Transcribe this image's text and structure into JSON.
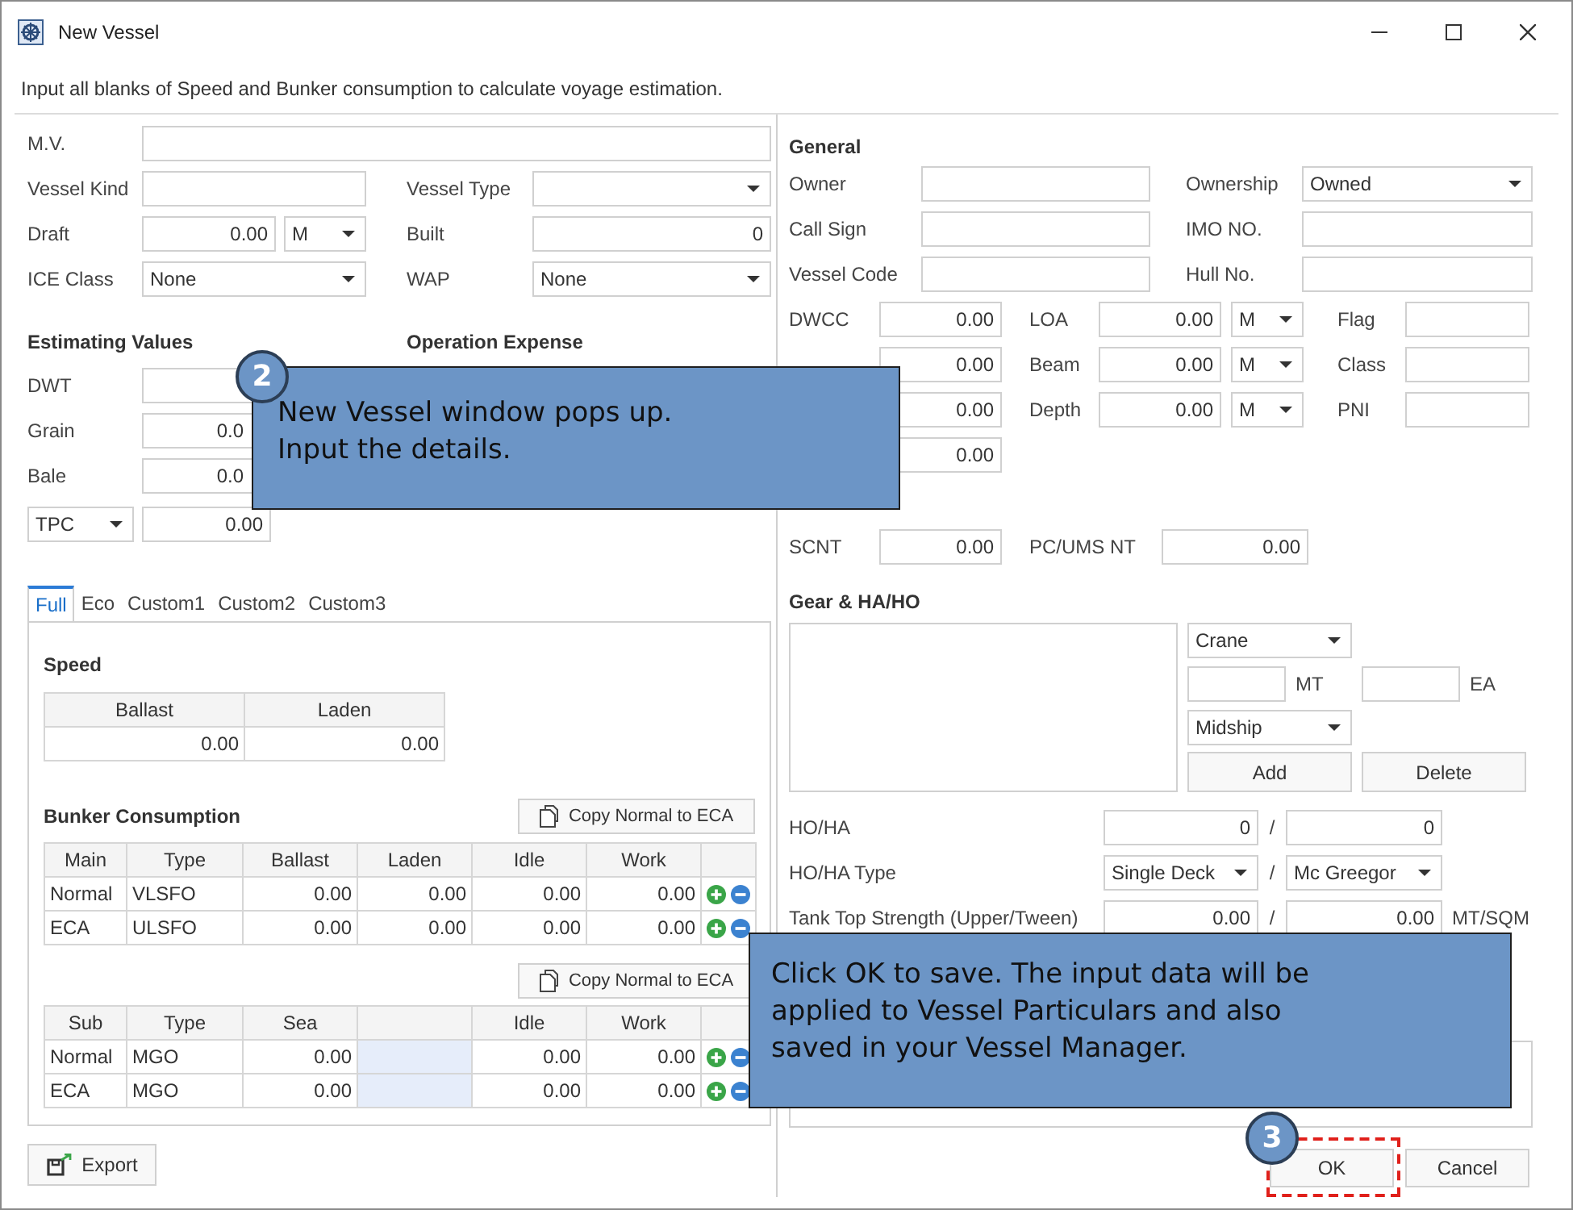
{
  "window": {
    "title": "New Vessel"
  },
  "instruction": "Input all blanks of Speed and Bunker consumption to calculate voyage estimation.",
  "particulars": {
    "rows": [
      {
        "items": [
          {
            "kind": "label",
            "text": "M.V."
          },
          {
            "kind": "text"
          }
        ]
      },
      {
        "items": [
          {
            "kind": "label",
            "text": "Vessel Kind"
          },
          {
            "kind": "text"
          },
          {
            "kind": "label",
            "text": "Vessel Type"
          },
          {
            "kind": "select"
          }
        ]
      },
      {
        "items": [
          {
            "kind": "label",
            "text": "Draft"
          },
          {
            "kind": "number",
            "value": "0.00"
          },
          {
            "kind": "select",
            "value": "M"
          },
          {
            "kind": "label",
            "text": "Built"
          },
          {
            "kind": "number",
            "value": "0"
          }
        ]
      },
      {
        "items": [
          {
            "kind": "label",
            "text": "ICE Class"
          },
          {
            "kind": "select",
            "value": "None"
          },
          {
            "kind": "label",
            "text": "WAP"
          },
          {
            "kind": "select",
            "value": "None"
          }
        ]
      }
    ]
  },
  "estimating": {
    "heading": "Estimating Values",
    "rows": [
      {
        "items": [
          {
            "kind": "label",
            "text": "DWT"
          },
          {
            "kind": "number"
          }
        ]
      },
      {
        "items": [
          {
            "kind": "label",
            "text": "Grain"
          },
          {
            "kind": "number",
            "value": "0.0"
          }
        ]
      },
      {
        "items": [
          {
            "kind": "label",
            "text": "Bale"
          },
          {
            "kind": "number",
            "value": "0.0"
          }
        ]
      },
      {
        "items": [
          {
            "kind": "select",
            "value": "TPC"
          },
          {
            "kind": "number",
            "value": "0.00"
          }
        ]
      }
    ]
  },
  "operation_expense": {
    "heading": "Operation Expense"
  },
  "consumption_tabs": [
    {
      "label": "Full",
      "selected": true
    },
    {
      "label": "Eco",
      "selected": false
    },
    {
      "label": "Custom1",
      "selected": false
    },
    {
      "label": "Custom2",
      "selected": false
    },
    {
      "label": "Custom3",
      "selected": false
    }
  ],
  "speed": {
    "heading": "Speed",
    "columns": [
      "Ballast",
      "Laden"
    ],
    "values": [
      "0.00",
      "0.00"
    ]
  },
  "bunker": {
    "heading": "Bunker Consumption",
    "copy_button": "Copy Normal to ECA",
    "columns": [
      {
        "label": "Main"
      },
      {
        "label": "Type"
      },
      {
        "label": "Ballast"
      },
      {
        "label": "Laden"
      },
      {
        "label": "Idle"
      },
      {
        "label": "Work"
      }
    ],
    "rows": [
      {
        "cells": [
          "Normal",
          "VLSFO",
          "0.00",
          "0.00",
          "0.00",
          "0.00"
        ]
      },
      {
        "cells": [
          "ECA",
          "ULSFO",
          "0.00",
          "0.00",
          "0.00",
          "0.00"
        ]
      }
    ]
  },
  "sub_bunker": {
    "copy_button": "Copy Normal to ECA",
    "columns": [
      {
        "label": "Sub",
        "disabled": false
      },
      {
        "label": "Type",
        "disabled": false
      },
      {
        "label": "Sea",
        "disabled": false
      },
      {
        "disabled": true
      },
      {
        "label": "Idle",
        "disabled": false
      },
      {
        "label": "Work",
        "disabled": false
      }
    ],
    "rows": [
      {
        "cells": [
          "Normal",
          "MGO",
          "0.00",
          null,
          "0.00",
          "0.00"
        ]
      },
      {
        "cells": [
          "ECA",
          "MGO",
          "0.00",
          null,
          "0.00",
          "0.00"
        ]
      }
    ]
  },
  "export_button": "Export",
  "general": {
    "heading": "General",
    "rows": [
      {
        "items": [
          {
            "kind": "label",
            "text": "Owner"
          },
          {
            "kind": "text"
          },
          {
            "kind": "label",
            "text": "Ownership"
          },
          {
            "kind": "select",
            "value": "Owned"
          }
        ]
      },
      {
        "items": [
          {
            "kind": "label",
            "text": "Call Sign"
          },
          {
            "kind": "text"
          },
          {
            "kind": "label",
            "text": "IMO NO."
          },
          {
            "kind": "text"
          }
        ]
      },
      {
        "items": [
          {
            "kind": "label",
            "text": "Vessel Code"
          },
          {
            "kind": "text"
          },
          {
            "kind": "label",
            "text": "Hull No."
          },
          {
            "kind": "text"
          }
        ]
      },
      {
        "items": [
          {
            "kind": "label",
            "text": "DWCC"
          },
          {
            "kind": "number",
            "value": "0.00"
          },
          {
            "kind": "label",
            "text": "LOA"
          },
          {
            "kind": "number",
            "value": "0.00"
          },
          {
            "kind": "select",
            "value": "M"
          },
          {
            "kind": "label",
            "text": "Flag"
          },
          {
            "kind": "text"
          }
        ]
      },
      {
        "items": [
          {
            "kind": "number",
            "value": "0.00"
          },
          {
            "kind": "label",
            "text": "Beam"
          },
          {
            "kind": "number",
            "value": "0.00"
          },
          {
            "kind": "select",
            "value": "M"
          },
          {
            "kind": "label",
            "text": "Class"
          },
          {
            "kind": "text"
          }
        ]
      },
      {
        "items": [
          {
            "kind": "number",
            "value": "0.00"
          },
          {
            "kind": "label",
            "text": "Depth"
          },
          {
            "kind": "number",
            "value": "0.00"
          },
          {
            "kind": "select",
            "value": "M"
          },
          {
            "kind": "label",
            "text": "PNI"
          },
          {
            "kind": "text"
          }
        ]
      },
      {
        "items": [
          {
            "kind": "number",
            "value": "0.00"
          }
        ]
      },
      {
        "items": [
          {
            "kind": "label",
            "text": "SCNT"
          },
          {
            "kind": "number",
            "value": "0.00"
          },
          {
            "kind": "label",
            "text": "PC/UMS NT"
          },
          {
            "kind": "number",
            "value": "0.00"
          }
        ]
      }
    ]
  },
  "gear": {
    "heading": "Gear & HA/HO",
    "gear_type": "Crane",
    "capacity_unit": "MT",
    "count_unit": "EA",
    "position": "Midship",
    "buttons": [
      "Add",
      "Delete"
    ]
  },
  "hatch_rows": [
    {
      "items": [
        {
          "kind": "label",
          "text": "HO/HA"
        },
        {
          "kind": "number",
          "value": "0"
        },
        {
          "kind": "separator",
          "text": "/"
        },
        {
          "kind": "number",
          "value": "0"
        }
      ]
    },
    {
      "items": [
        {
          "kind": "label",
          "text": "HO/HA Type"
        },
        {
          "kind": "select",
          "value": "Single Deck"
        },
        {
          "kind": "separator",
          "text": "/"
        },
        {
          "kind": "select",
          "value": "Mc Greegor"
        }
      ]
    },
    {
      "items": [
        {
          "kind": "label",
          "text": "Tank Top Strength (Upper/Tween)"
        },
        {
          "kind": "number",
          "value": "0.00"
        },
        {
          "kind": "separator",
          "text": "/"
        },
        {
          "kind": "number",
          "value": "0.00"
        },
        {
          "kind": "label",
          "text": "MT/SQM"
        }
      ]
    }
  ],
  "dialog_buttons": [
    {
      "label": "OK",
      "highlighted": true
    },
    {
      "label": "Cancel",
      "highlighted": false
    }
  ],
  "callouts": [
    {
      "number": "2",
      "lines": [
        "New Vessel window pops up.",
        "Input the details."
      ]
    },
    {
      "number": "3",
      "lines": [
        "Click OK to save. The input data will be",
        "applied to Vessel Particulars and also",
        "saved in your Vessel Manager."
      ]
    }
  ]
}
